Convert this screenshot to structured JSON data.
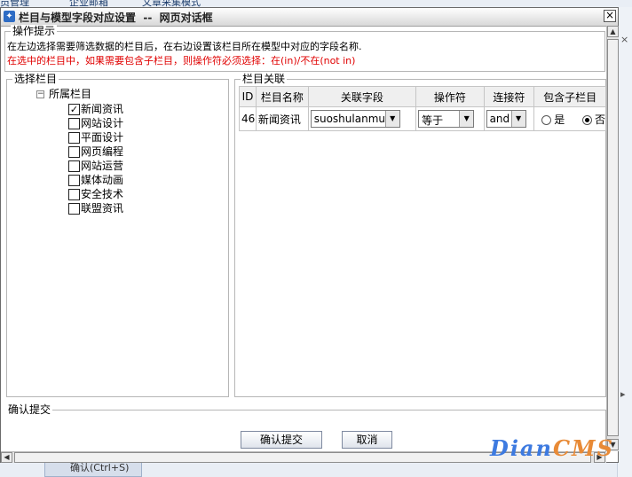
{
  "background": {
    "top_tabs": [
      "员管理",
      "企业邮箱",
      "文章采集模式"
    ],
    "bottom_tab_label": "确认(Ctrl+S)"
  },
  "dialog": {
    "title": "栏目与模型字段对应设置  --  网页对话框",
    "close_symbol": "×"
  },
  "hint_section": {
    "legend": "操作提示",
    "line1": "在左边选择需要筛选数据的栏目后，在右边设置该栏目所在模型中对应的字段名称.",
    "line2": "在选中的栏目中，如果需要包含子栏目，则操作符必须选择：在(in)/不在(not in)"
  },
  "category_panel": {
    "legend": "选择栏目",
    "root_label": "所属栏目",
    "expander": "−",
    "items": [
      {
        "label": "新闻资讯",
        "checked": true
      },
      {
        "label": "网站设计",
        "checked": false
      },
      {
        "label": "平面设计",
        "checked": false
      },
      {
        "label": "网页编程",
        "checked": false
      },
      {
        "label": "网站运营",
        "checked": false
      },
      {
        "label": "媒体动画",
        "checked": false
      },
      {
        "label": "安全技术",
        "checked": false
      },
      {
        "label": "联盟资讯",
        "checked": false
      }
    ]
  },
  "relation_panel": {
    "legend": "栏目关联",
    "columns": [
      "ID",
      "栏目名称",
      "关联字段",
      "操作符",
      "连接符",
      "包含子栏目"
    ],
    "rows": [
      {
        "id": "46",
        "name": "新闻资讯",
        "field": "suoshulanmu",
        "operator": "等于",
        "connector": "and",
        "include_yes_label": "是",
        "include_no_label": "否",
        "include_children": "否"
      }
    ]
  },
  "confirm_section": {
    "legend": "确认提交",
    "submit_label": "确认提交",
    "cancel_label": "取消"
  },
  "watermark": {
    "part1": "Dian",
    "part2": "CMS"
  },
  "colors": {
    "hint_red": "#e00000",
    "watermark_blue": "#3d7ae0",
    "watermark_orange": "#e88a36"
  },
  "icons": [
    "dialog-app-icon",
    "close-icon",
    "scroll-up-icon",
    "scroll-down-icon",
    "scroll-left-icon",
    "scroll-right-icon",
    "tree-collapse-icon",
    "dropdown-arrow-icon"
  ]
}
